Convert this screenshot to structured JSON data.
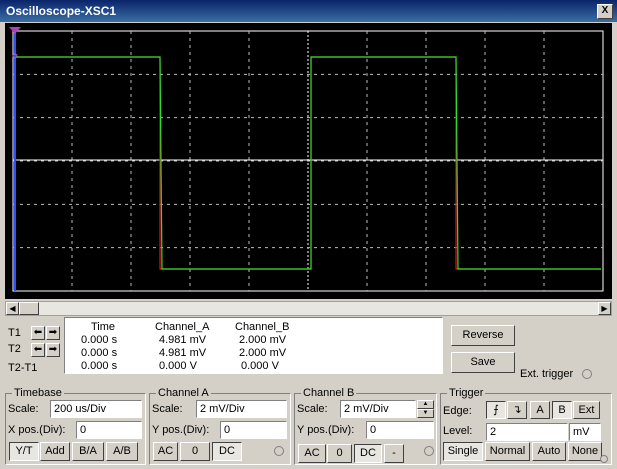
{
  "window": {
    "title": "Oscilloscope-XSC1",
    "close_label": "X"
  },
  "colors": {
    "channel_a": "#d01818",
    "channel_b": "#2ee02e",
    "background": "#000000",
    "grid": "#ffffff"
  },
  "readout": {
    "headers": [
      "Time",
      "Channel_A",
      "Channel_B"
    ],
    "rows": [
      {
        "label": "T1",
        "time": "0.000 s",
        "a": "4.981 mV",
        "b": "2.000 mV"
      },
      {
        "label": "T2",
        "time": "0.000 s",
        "a": "4.981 mV",
        "b": "2.000 mV"
      },
      {
        "label": "T2-T1",
        "time": "0.000 s",
        "a": "0.000 V",
        "b": "0.000 V"
      }
    ]
  },
  "actions": {
    "reverse": "Reverse",
    "save": "Save",
    "ext_trigger": "Ext. trigger"
  },
  "timebase": {
    "title": "Timebase",
    "scale_label": "Scale:",
    "scale": "200 us/Div",
    "xpos_label": "X pos.(Div):",
    "xpos": "0",
    "modes": [
      "Y/T",
      "Add",
      "B/A",
      "A/B"
    ],
    "active_mode": "Y/T"
  },
  "channel_a": {
    "title": "Channel A",
    "scale_label": "Scale:",
    "scale": "2 mV/Div",
    "ypos_label": "Y pos.(Div):",
    "ypos": "0",
    "coupling": [
      "AC",
      "0",
      "DC"
    ],
    "active": "DC"
  },
  "channel_b": {
    "title": "Channel B",
    "scale_label": "Scale:",
    "scale": "2 mV/Div",
    "ypos_label": "Y pos.(Div):",
    "ypos": "0",
    "coupling": [
      "AC",
      "0",
      "DC",
      "-"
    ],
    "active": "DC"
  },
  "trigger": {
    "title": "Trigger",
    "edge_label": "Edge:",
    "sources": [
      "A",
      "B",
      "Ext"
    ],
    "active_source": "B",
    "level_label": "Level:",
    "level": "2",
    "level_unit": "mV",
    "modes": [
      "Single",
      "Normal",
      "Auto",
      "None"
    ],
    "active_mode": "Single"
  },
  "icons": {
    "rise": "rising-edge-icon",
    "fall": "falling-edge-icon",
    "left": "arrow-left-icon",
    "right": "arrow-right-icon"
  }
}
